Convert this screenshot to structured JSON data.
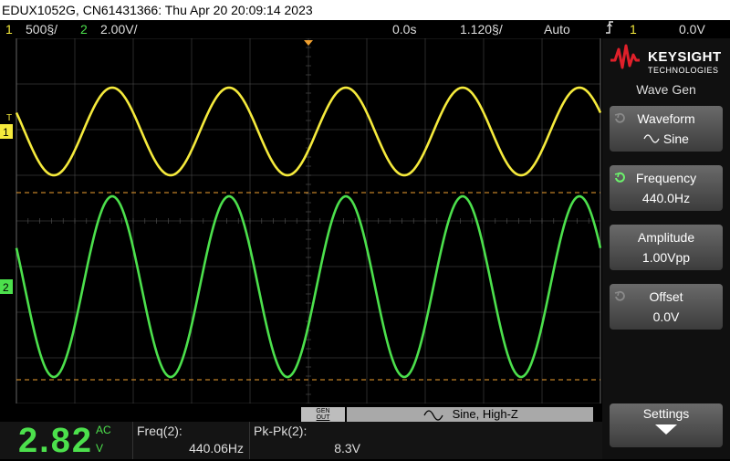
{
  "title_bar": {
    "text": "EDUX1052G, CN61431366: Thu Apr 20 20:09:14 2023"
  },
  "status_bar": {
    "ch1_number": "1",
    "ch1_scale": "500§/",
    "ch2_number": "2",
    "ch2_scale": "2.00V/",
    "time_delay": "0.0s",
    "time_scale": "1.120§/",
    "trigger_mode": "Auto",
    "trigger_icon": "trigger-edge-icon",
    "trigger_source": "1",
    "trigger_level": "0.0V"
  },
  "channel_markers": {
    "ch1": "1",
    "ch2": "2",
    "trigger_t": "T"
  },
  "right_panel": {
    "logo": "KEYSIGHT",
    "logo_subtitle": "TECHNOLOGIES",
    "menu_title": "Wave Gen",
    "softkeys": [
      {
        "label": "Waveform",
        "value": "Sine",
        "value_icon": "sine-wave-icon"
      },
      {
        "label": "Frequency",
        "value": "440.0Hz",
        "active": true
      },
      {
        "label": "Amplitude",
        "value": "1.00Vpp"
      },
      {
        "label": "Offset",
        "value": "0.0V"
      }
    ],
    "settings_label": "Settings"
  },
  "wavegen_bar": {
    "button_line1": "GEN",
    "button_line2": "OUT",
    "status": "Sine, High-Z"
  },
  "measurements": {
    "dvm_value": "2.82",
    "dvm_mode": "AC",
    "dvm_unit": "V",
    "freq_label": "Freq(2):",
    "freq_value": "440.06Hz",
    "pkpk_label": "Pk-Pk(2):",
    "pkpk_value": "8.3V"
  },
  "waveforms": {
    "ch1_color": "#f5ea3c",
    "ch2_color": "#4ce04c",
    "cycles_visible": 5
  },
  "colors": {
    "ch1": "#f5ea3c",
    "ch2": "#4ce04c",
    "trigger_marker": "#f0a030",
    "grid": "#555555",
    "background": "#000000"
  }
}
